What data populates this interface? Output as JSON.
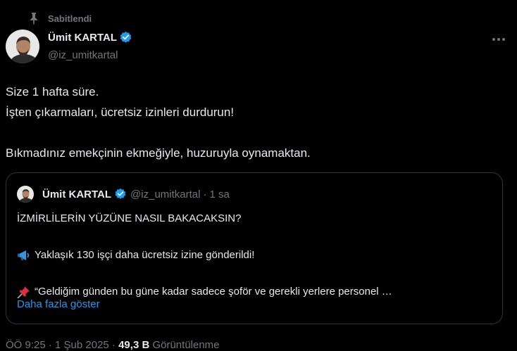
{
  "pinned": {
    "label": "Sabitlendi",
    "icon": "pin-icon"
  },
  "author": {
    "name": "Ümit KARTAL",
    "handle": "@iz_umitkartal",
    "verified": true,
    "verified_color": "#1d9bf0"
  },
  "tweet": {
    "lines": [
      "Size 1 hafta süre.",
      "İşten çıkarmaları, ücretsiz izinleri durdurun!",
      "",
      "Bıkmadınız emekçinin ekmeğiyle, huzuruyla oynamaktan."
    ]
  },
  "quote": {
    "name": "Ümit KARTAL",
    "handle": "@iz_umitkartal",
    "separator": "·",
    "time": "1 sa",
    "line1": "İZMİRLİLERİN YÜZÜNE NASIL BAKACAKSIN?",
    "line2": "Yaklaşık 130 işçi daha ücretsiz izine gönderildi!",
    "line3": "“Geldiğim günden bu güne kadar sadece şoför ve gerekli yerlere personel …",
    "show_more": "Daha fazla göster",
    "line2_icon": "megaphone-icon",
    "line3_icon": "pushpin-icon"
  },
  "meta": {
    "partial_text": "ÖÖ 9:25 · 1 Şub 2025 · ",
    "views_value": "49,3 B",
    "views_label": " Görüntülenme"
  },
  "colors": {
    "background": "#000000",
    "text": "#e7e9ea",
    "secondary": "#71767b",
    "accent": "#1d9bf0",
    "border": "#2f3336"
  }
}
